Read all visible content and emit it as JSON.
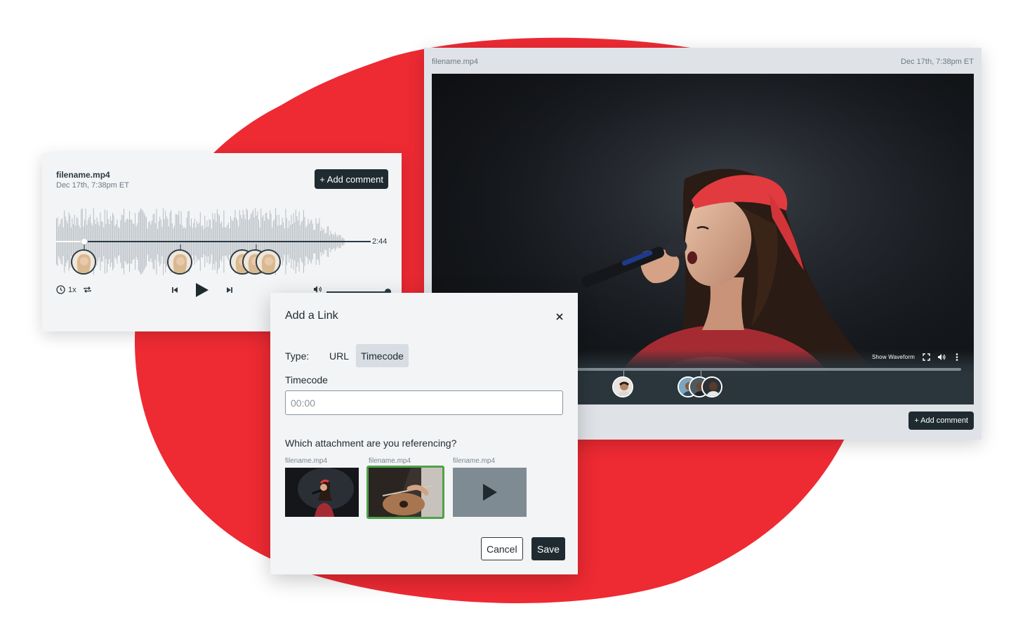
{
  "colors": {
    "accent_red": "#ee2a33",
    "dark": "#1f2b31",
    "selected_green": "#4ea24a",
    "panel_bg": "#f3f4f6",
    "video_panel_bg": "#dfe3e7"
  },
  "video_window": {
    "filename": "filename.mp4",
    "date": "Dec 17th, 7:38pm ET",
    "show_waveform_label": "Show Waveform",
    "icons": [
      "fullscreen-icon",
      "volume-icon",
      "more-vertical-icon"
    ],
    "add_comment_label": "+ Add comment",
    "comment_marker_count": 2
  },
  "audio_window": {
    "filename": "filename.mp4",
    "date": "Dec 17th, 7:38pm ET",
    "add_comment_label": "+ Add comment",
    "duration": "2:44",
    "speed_label": "1x",
    "comment_marker_count": 5,
    "icons": [
      "clock-icon",
      "repeat-icon",
      "skip-back-icon",
      "play-icon",
      "skip-forward-icon",
      "volume-icon"
    ]
  },
  "dialog": {
    "title": "Add a Link",
    "type_label": "Type:",
    "type_options": [
      "URL",
      "Timecode"
    ],
    "selected_type": "Timecode",
    "field_label": "Timecode",
    "input_placeholder": "00:00",
    "input_value": "",
    "question": "Which attachment are you referencing?",
    "attachments": [
      {
        "name": "filename.mp4",
        "thumb": "singer-photo"
      },
      {
        "name": "filename.mp4",
        "thumb": "guitar-photo",
        "selected": true
      },
      {
        "name": "filename.mp4",
        "thumb": "video-placeholder"
      }
    ],
    "cancel_label": "Cancel",
    "save_label": "Save"
  }
}
